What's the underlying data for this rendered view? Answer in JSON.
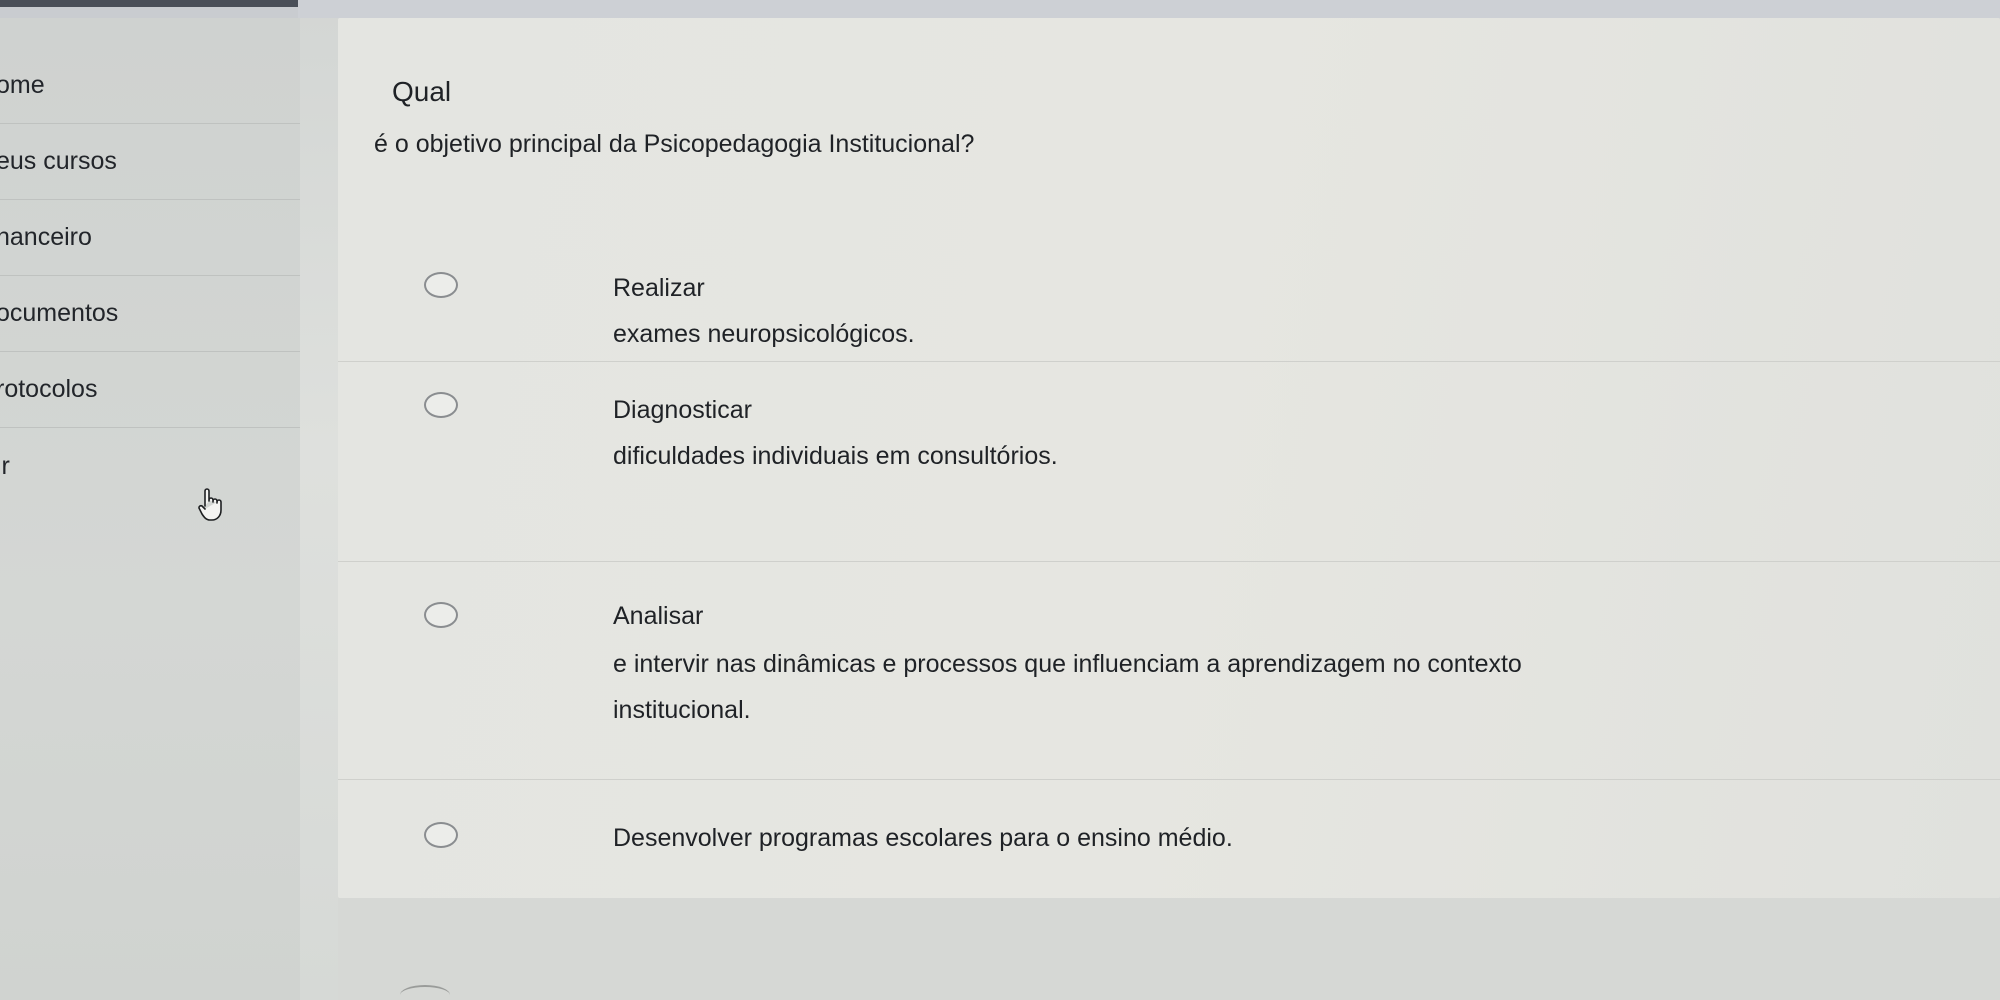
{
  "sidebar": {
    "items": [
      {
        "label": "ome"
      },
      {
        "label": "eus cursos"
      },
      {
        "label": "nanceiro"
      },
      {
        "label": "ocumentos"
      },
      {
        "label": "rotocolos"
      },
      {
        "label": "ir"
      }
    ]
  },
  "question": {
    "word": "Qual",
    "text": "é o objetivo principal da Psicopedagogia Institucional?"
  },
  "options": [
    {
      "lines": [
        "Realizar",
        "exames neuropsicológicos."
      ]
    },
    {
      "lines": [
        "Diagnosticar",
        "dificuldades individuais em consultórios."
      ]
    },
    {
      "lines": [
        "Analisar",
        "e intervir nas dinâmicas e processos que influenciam a aprendizagem no contexto",
        "institucional."
      ]
    },
    {
      "lines": [
        "Desenvolver programas escolares para o ensino médio."
      ]
    }
  ],
  "icons": {
    "cursor": "hand-pointer-icon",
    "radio": "radio-unchecked-icon"
  },
  "colors": {
    "text": "#1f2226",
    "sidebar_bg": "#d2d5d2",
    "panel_bg": "#e4e5e1",
    "radio_border": "#8a8d90"
  }
}
